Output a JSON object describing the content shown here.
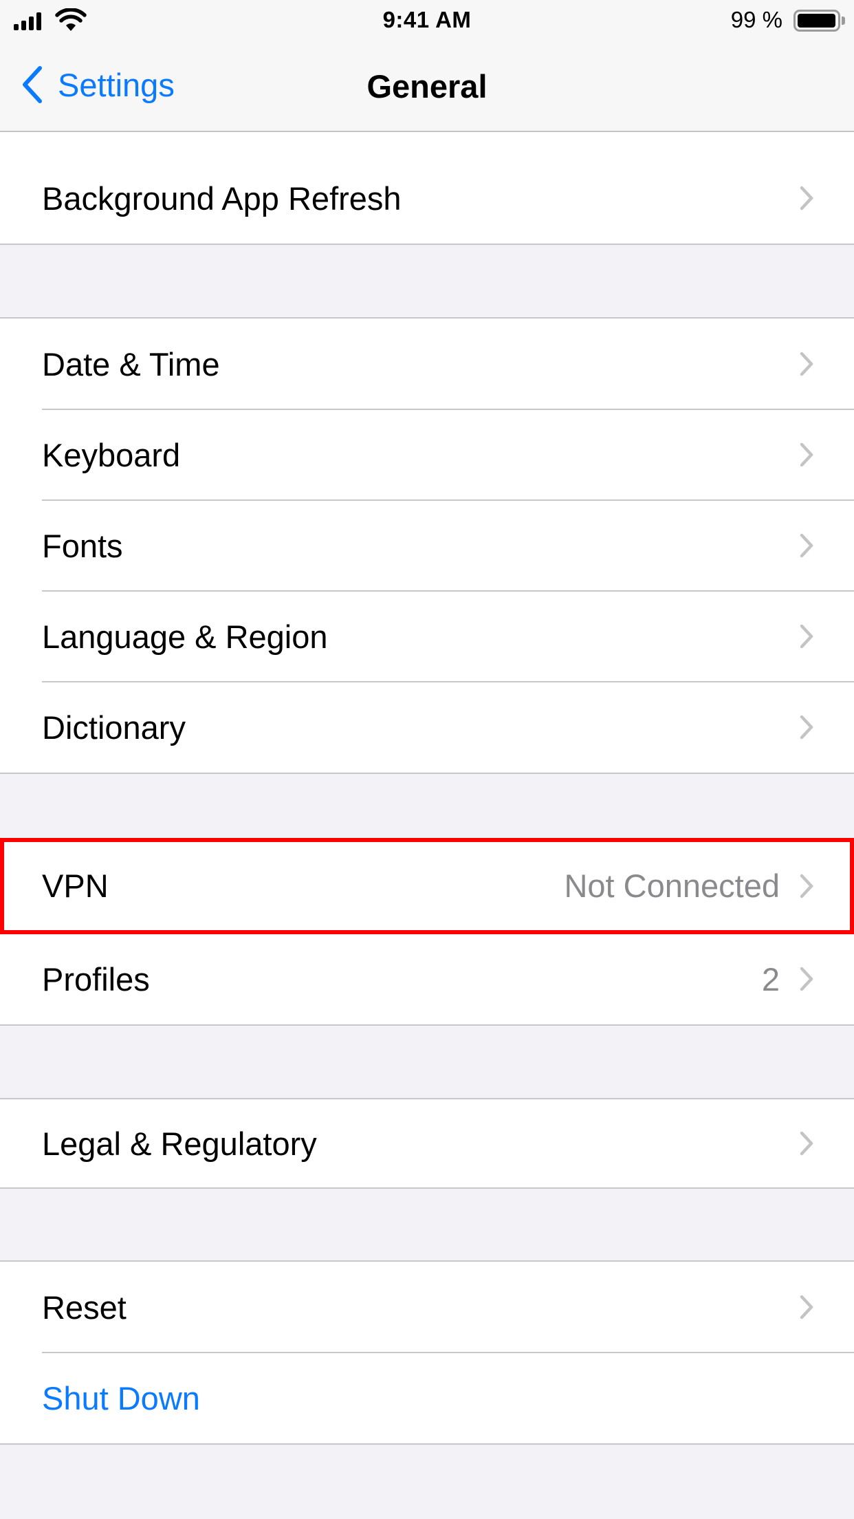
{
  "status_bar": {
    "time": "9:41 AM",
    "battery_percent": "99 %",
    "battery_level": 0.99,
    "signal_bars": 4,
    "wifi": true
  },
  "nav": {
    "back_label": "Settings",
    "back_icon": "chevron-left-icon",
    "title": "General"
  },
  "sections": [
    {
      "rows": [
        {
          "label": "Background App Refresh",
          "value": "",
          "chevron": true
        }
      ]
    },
    {
      "rows": [
        {
          "label": "Date & Time",
          "value": "",
          "chevron": true
        },
        {
          "label": "Keyboard",
          "value": "",
          "chevron": true
        },
        {
          "label": "Fonts",
          "value": "",
          "chevron": true
        },
        {
          "label": "Language & Region",
          "value": "",
          "chevron": true
        },
        {
          "label": "Dictionary",
          "value": "",
          "chevron": true
        }
      ]
    },
    {
      "rows": [
        {
          "label": "VPN",
          "value": "Not Connected",
          "chevron": true,
          "highlighted": true
        },
        {
          "label": "Profiles",
          "value": "2",
          "chevron": true
        }
      ]
    },
    {
      "rows": [
        {
          "label": "Legal & Regulatory",
          "value": "",
          "chevron": true
        }
      ]
    },
    {
      "rows": [
        {
          "label": "Reset",
          "value": "",
          "chevron": true
        },
        {
          "label": "Shut Down",
          "value": "",
          "chevron": false,
          "style": "action"
        }
      ]
    }
  ],
  "colors": {
    "accent": "#0a7aff",
    "highlight_box": "#ff0000",
    "grouped_background": "#f2f2f7",
    "secondary_text": "#8a8a8e",
    "chevron": "#c4c4c7"
  }
}
